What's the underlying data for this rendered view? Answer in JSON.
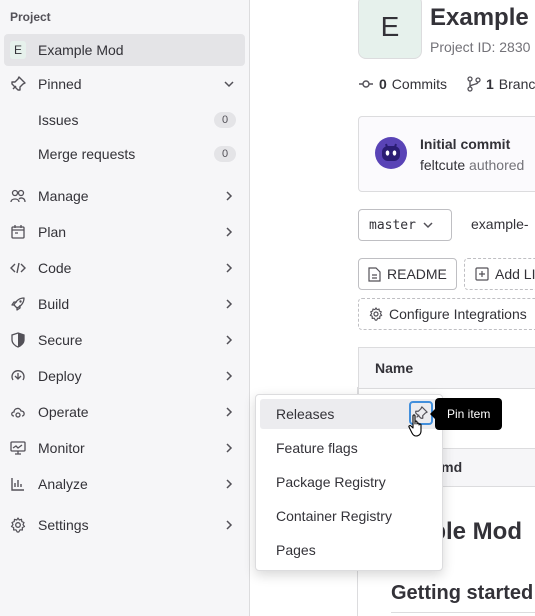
{
  "sidebar": {
    "heading": "Project",
    "project": {
      "avatar_letter": "E",
      "label": "Example Mod"
    },
    "pinned": {
      "label": "Pinned",
      "items": [
        {
          "label": "Issues",
          "count": "0"
        },
        {
          "label": "Merge requests",
          "count": "0"
        }
      ]
    },
    "sections": [
      {
        "label": "Manage",
        "icon": "users-icon"
      },
      {
        "label": "Plan",
        "icon": "planning-icon"
      },
      {
        "label": "Code",
        "icon": "code-icon"
      },
      {
        "label": "Build",
        "icon": "rocket-icon"
      },
      {
        "label": "Secure",
        "icon": "shield-icon"
      },
      {
        "label": "Deploy",
        "icon": "deployments-icon"
      },
      {
        "label": "Operate",
        "icon": "cloud-gear-icon"
      },
      {
        "label": "Monitor",
        "icon": "monitor-icon"
      },
      {
        "label": "Analyze",
        "icon": "chart-icon"
      }
    ],
    "settings": {
      "label": "Settings",
      "icon": "gear-icon"
    }
  },
  "main": {
    "avatar_letter": "E",
    "title": "Example Mod",
    "project_id": "Project ID: 2830",
    "commits": {
      "count": "0",
      "label": "Commits"
    },
    "branches": {
      "count": "1",
      "label": "Branc"
    },
    "last_commit": {
      "title": "Initial commit",
      "author": "feltcute",
      "verb": "authored"
    },
    "branch_select": "master",
    "path": "example-",
    "buttons": {
      "readme": "README",
      "add_license": "Add LI",
      "configure": "Configure Integrations"
    },
    "table_header": "Name",
    "readme_file": "IE.md",
    "readme_h1": "mple Mod",
    "readme_h2": "Getting started"
  },
  "flyout": {
    "items": [
      "Releases",
      "Feature flags",
      "Package Registry",
      "Container Registry",
      "Pages"
    ]
  },
  "tooltip": "Pin item",
  "colors": {
    "accent": "#1f75cb",
    "focus": "#428fdc",
    "avatar_bg": "#e6f1ec",
    "bot": "#5943b6"
  }
}
